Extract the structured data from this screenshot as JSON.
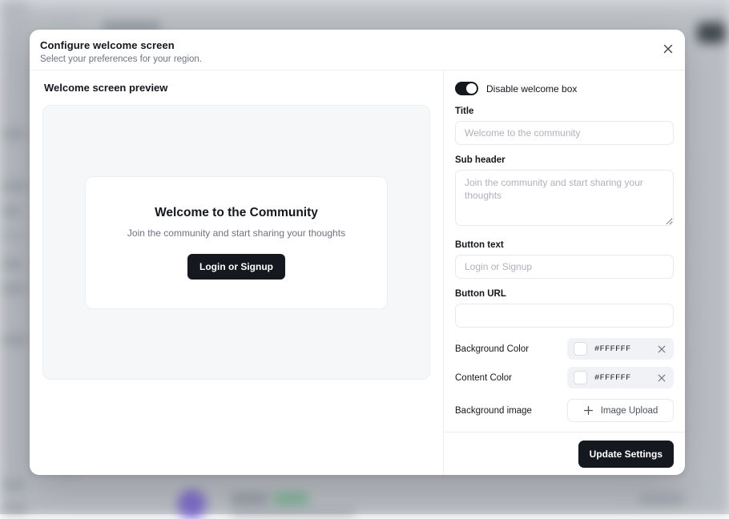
{
  "modal": {
    "title": "Configure welcome screen",
    "subtitle": "Select your preferences for your region.",
    "close_icon": "close-icon"
  },
  "preview": {
    "heading": "Welcome screen preview",
    "welcome_title": "Welcome to the Community",
    "welcome_subtitle": "Join the community and start sharing your thoughts",
    "cta_label": "Login or Signup"
  },
  "form": {
    "toggle_label": "Disable welcome box",
    "toggle_state": "on",
    "title_label": "Title",
    "title_value": "",
    "title_placeholder": "Welcome to the community",
    "subheader_label": "Sub header",
    "subheader_value": "",
    "subheader_placeholder": "Join the community and start sharing your thoughts",
    "button_text_label": "Button text",
    "button_text_value": "",
    "button_text_placeholder": "Login or Signup",
    "button_url_label": "Button URL",
    "button_url_value": "",
    "button_url_placeholder": "",
    "background_color_label": "Background Color",
    "background_color_value": "#FFFFFF",
    "content_color_label": "Content Color",
    "content_color_value": "#FFFFFF",
    "clear_icon": "close-icon",
    "background_image_label": "Background image",
    "upload_button_label": "Image Upload",
    "upload_icon": "plus-icon"
  },
  "footer": {
    "update_label": "Update Settings"
  },
  "colors": {
    "accent_dark": "#15181E",
    "text_primary": "#14171C",
    "text_muted": "#6D7380",
    "border": "#ECEEF1",
    "canvas": "#F6F7F9",
    "control_bg": "#F1F2F5"
  }
}
